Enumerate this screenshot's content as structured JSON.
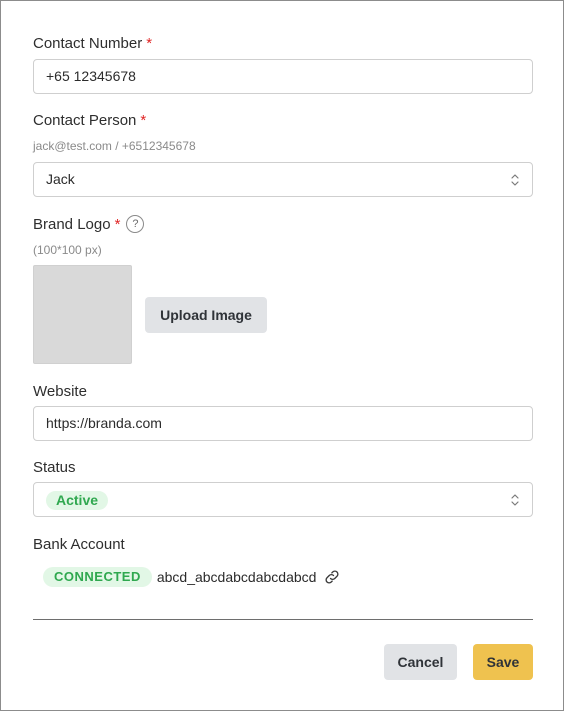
{
  "contact_number": {
    "label": "Contact Number",
    "required_mark": "*",
    "value": "+65 12345678"
  },
  "contact_person": {
    "label": "Contact Person",
    "required_mark": "*",
    "hint": "jack@test.com / +6512345678",
    "selected": "Jack",
    "icon": "chevron-up-down-icon"
  },
  "brand_logo": {
    "label": "Brand Logo",
    "required_mark": "*",
    "help_icon": "?",
    "hint": "(100*100 px)",
    "upload_label": "Upload Image"
  },
  "website": {
    "label": "Website",
    "value": "https://branda.com"
  },
  "status": {
    "label": "Status",
    "selected": "Active",
    "icon": "chevron-up-down-icon"
  },
  "bank_account": {
    "label": "Bank Account",
    "badge": "CONNECTED",
    "account": "abcd_abcdabcdabcdabcd",
    "icon": "link-icon"
  },
  "footer": {
    "cancel_label": "Cancel",
    "save_label": "Save"
  },
  "colors": {
    "required": "#e02424",
    "status_green": "#2fa84f",
    "status_green_bg": "#e2f7e6",
    "save_yellow": "#efc24f",
    "secondary_button": "#e1e3e6"
  }
}
